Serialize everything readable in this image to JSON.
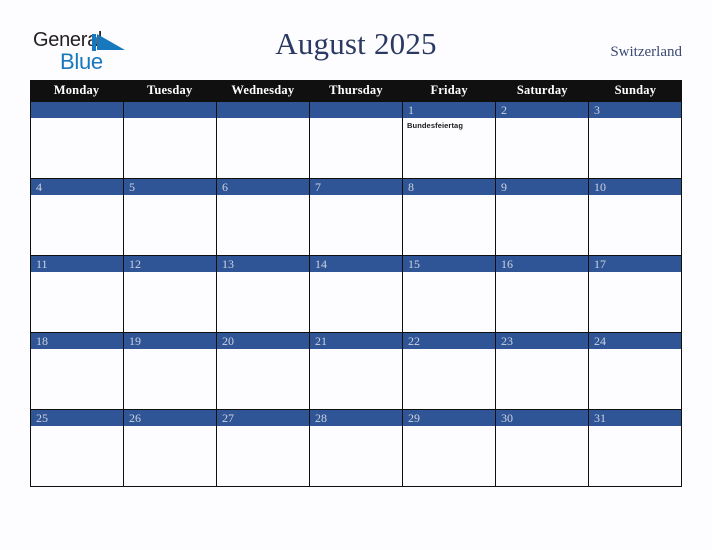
{
  "brand": {
    "name_part1": "General",
    "name_part2": "Blue",
    "triangle_icon": "triangle-logo-icon",
    "accent_color": "#1878be",
    "text_color": "#231f20"
  },
  "header": {
    "title": "August 2025",
    "region": "Switzerland",
    "title_color": "#2b3a63"
  },
  "calendar": {
    "month": "August",
    "year": "2025",
    "weekday_headers": [
      "Monday",
      "Tuesday",
      "Wednesday",
      "Thursday",
      "Friday",
      "Saturday",
      "Sunday"
    ],
    "header_bg": "#101010",
    "header_text_color": "#ffffff",
    "day_bar_color": "#2f5596",
    "day_number_color": "#ccd2de",
    "cell_bg": "#fdfdff",
    "border_color": "#101010",
    "weeks": [
      [
        {
          "num": "",
          "events": []
        },
        {
          "num": "",
          "events": []
        },
        {
          "num": "",
          "events": []
        },
        {
          "num": "",
          "events": []
        },
        {
          "num": "1",
          "events": [
            "Bundesfeiertag"
          ]
        },
        {
          "num": "2",
          "events": []
        },
        {
          "num": "3",
          "events": []
        }
      ],
      [
        {
          "num": "4",
          "events": []
        },
        {
          "num": "5",
          "events": []
        },
        {
          "num": "6",
          "events": []
        },
        {
          "num": "7",
          "events": []
        },
        {
          "num": "8",
          "events": []
        },
        {
          "num": "9",
          "events": []
        },
        {
          "num": "10",
          "events": []
        }
      ],
      [
        {
          "num": "11",
          "events": []
        },
        {
          "num": "12",
          "events": []
        },
        {
          "num": "13",
          "events": []
        },
        {
          "num": "14",
          "events": []
        },
        {
          "num": "15",
          "events": []
        },
        {
          "num": "16",
          "events": []
        },
        {
          "num": "17",
          "events": []
        }
      ],
      [
        {
          "num": "18",
          "events": []
        },
        {
          "num": "19",
          "events": []
        },
        {
          "num": "20",
          "events": []
        },
        {
          "num": "21",
          "events": []
        },
        {
          "num": "22",
          "events": []
        },
        {
          "num": "23",
          "events": []
        },
        {
          "num": "24",
          "events": []
        }
      ],
      [
        {
          "num": "25",
          "events": []
        },
        {
          "num": "26",
          "events": []
        },
        {
          "num": "27",
          "events": []
        },
        {
          "num": "28",
          "events": []
        },
        {
          "num": "29",
          "events": []
        },
        {
          "num": "30",
          "events": []
        },
        {
          "num": "31",
          "events": []
        }
      ]
    ]
  }
}
